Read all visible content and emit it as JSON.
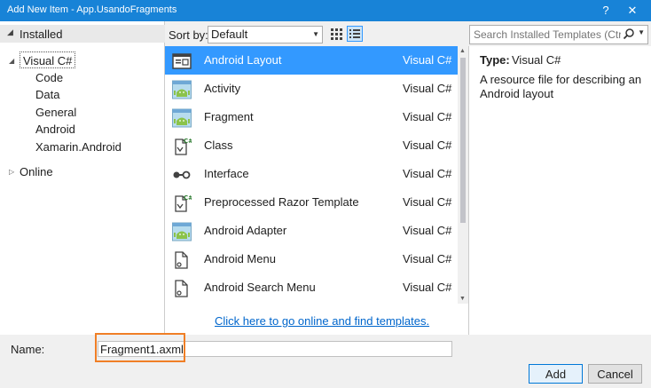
{
  "window": {
    "title": "Add New Item - App.UsandoFragments",
    "help_label": "?",
    "close_label": "✕"
  },
  "sidebar": {
    "installed_label": "Installed",
    "items": [
      {
        "label": "Visual C#"
      },
      {
        "label": "Code"
      },
      {
        "label": "Data"
      },
      {
        "label": "General"
      },
      {
        "label": "Android"
      },
      {
        "label": "Xamarin.Android"
      }
    ],
    "online_label": "Online"
  },
  "toolbar": {
    "sort_label": "Sort by:",
    "sort_value": "Default",
    "search_placeholder": "Search Installed Templates (Ctrl+E)"
  },
  "templates": [
    {
      "name": "Android Layout",
      "lang": "Visual C#",
      "icon": "layout-icon",
      "selected": true
    },
    {
      "name": "Activity",
      "lang": "Visual C#",
      "icon": "android-icon"
    },
    {
      "name": "Fragment",
      "lang": "Visual C#",
      "icon": "android-icon"
    },
    {
      "name": "Class",
      "lang": "Visual C#",
      "icon": "csharp-file-icon"
    },
    {
      "name": "Interface",
      "lang": "Visual C#",
      "icon": "interface-icon"
    },
    {
      "name": "Preprocessed Razor Template",
      "lang": "Visual C#",
      "icon": "csharp-file-icon"
    },
    {
      "name": "Android Adapter",
      "lang": "Visual C#",
      "icon": "android-icon"
    },
    {
      "name": "Android Menu",
      "lang": "Visual C#",
      "icon": "file-icon"
    },
    {
      "name": "Android Search Menu",
      "lang": "Visual C#",
      "icon": "file-icon"
    }
  ],
  "online_link": "Click here to go online and find templates.",
  "details": {
    "type_label": "Type:",
    "type_value": "Visual C#",
    "description": "A resource file for describing an Android layout"
  },
  "footer": {
    "name_label": "Name:",
    "name_value": "Fragment1.axml",
    "add_label": "Add",
    "cancel_label": "Cancel"
  },
  "colors": {
    "accent": "#1883d7",
    "selection": "#3399ff",
    "highlight": "#f07f26",
    "link": "#0066cc"
  }
}
